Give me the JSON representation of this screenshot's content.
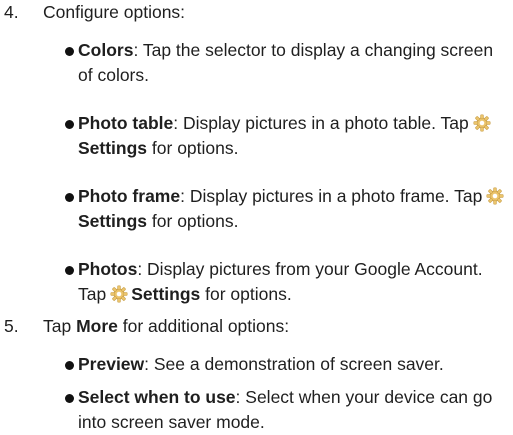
{
  "steps": [
    {
      "number": "4.",
      "text": "Configure options:",
      "bullets": [
        {
          "term": "Colors",
          "pre": ": Tap the selector to display a changing screen of colors."
        },
        {
          "term": "Photo table",
          "pre": ": Display pictures in a photo table. Tap",
          "link": "Settings",
          "post": " for options."
        },
        {
          "term": "Photo frame",
          "pre": ": Display pictures in a photo frame. Tap",
          "link": "Settings",
          "post": " for options."
        },
        {
          "term": "Photos",
          "pre": ": Display pictures from your Google Account. Tap",
          "link": "Settings",
          "post": " for options."
        }
      ]
    },
    {
      "number": "5.",
      "text_pre": "Tap ",
      "text_bold": "More",
      "text_post": " for additional options:",
      "bullets": [
        {
          "term": "Preview",
          "pre": ": See a demonstration of screen saver."
        },
        {
          "term": "Select when to use",
          "pre": ": Select when your device can go into screen saver mode."
        }
      ]
    }
  ],
  "icons": {
    "settings": "gear-icon"
  },
  "colors": {
    "text": "#1f1f1f",
    "gear": "#e8c06a"
  }
}
